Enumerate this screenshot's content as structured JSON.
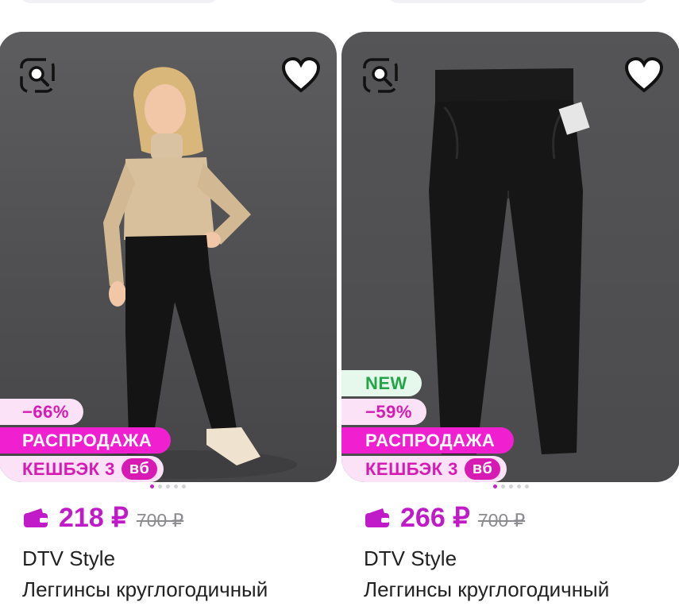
{
  "products": [
    {
      "image_alt": "girl-in-beige-sweater-and-black-trousers",
      "badges": {
        "new": "",
        "discount": "−66%",
        "sale": "РАСПРОДАЖА",
        "cashback_label": "КЕШБЭК 3",
        "cashback_unit": "вб"
      },
      "price": "218 ₽",
      "old_price": "700 ₽",
      "brand": "DTV Style",
      "title": "Леггинсы круглогодичный",
      "carousel_dots": 5,
      "active_dot": 0
    },
    {
      "image_alt": "black-trousers-hanging",
      "badges": {
        "new": "NEW",
        "discount": "−59%",
        "sale": "РАСПРОДАЖА",
        "cashback_label": "КЕШБЭК 3",
        "cashback_unit": "вб"
      },
      "price": "266 ₽",
      "old_price": "700 ₽",
      "brand": "DTV Style",
      "title": "Леггинсы круглогодичный",
      "carousel_dots": 5,
      "active_dot": 0
    }
  ],
  "colors": {
    "accent": "#c01ac9",
    "sale_badge": "#f020d0",
    "new_badge_text": "#24a54a"
  }
}
